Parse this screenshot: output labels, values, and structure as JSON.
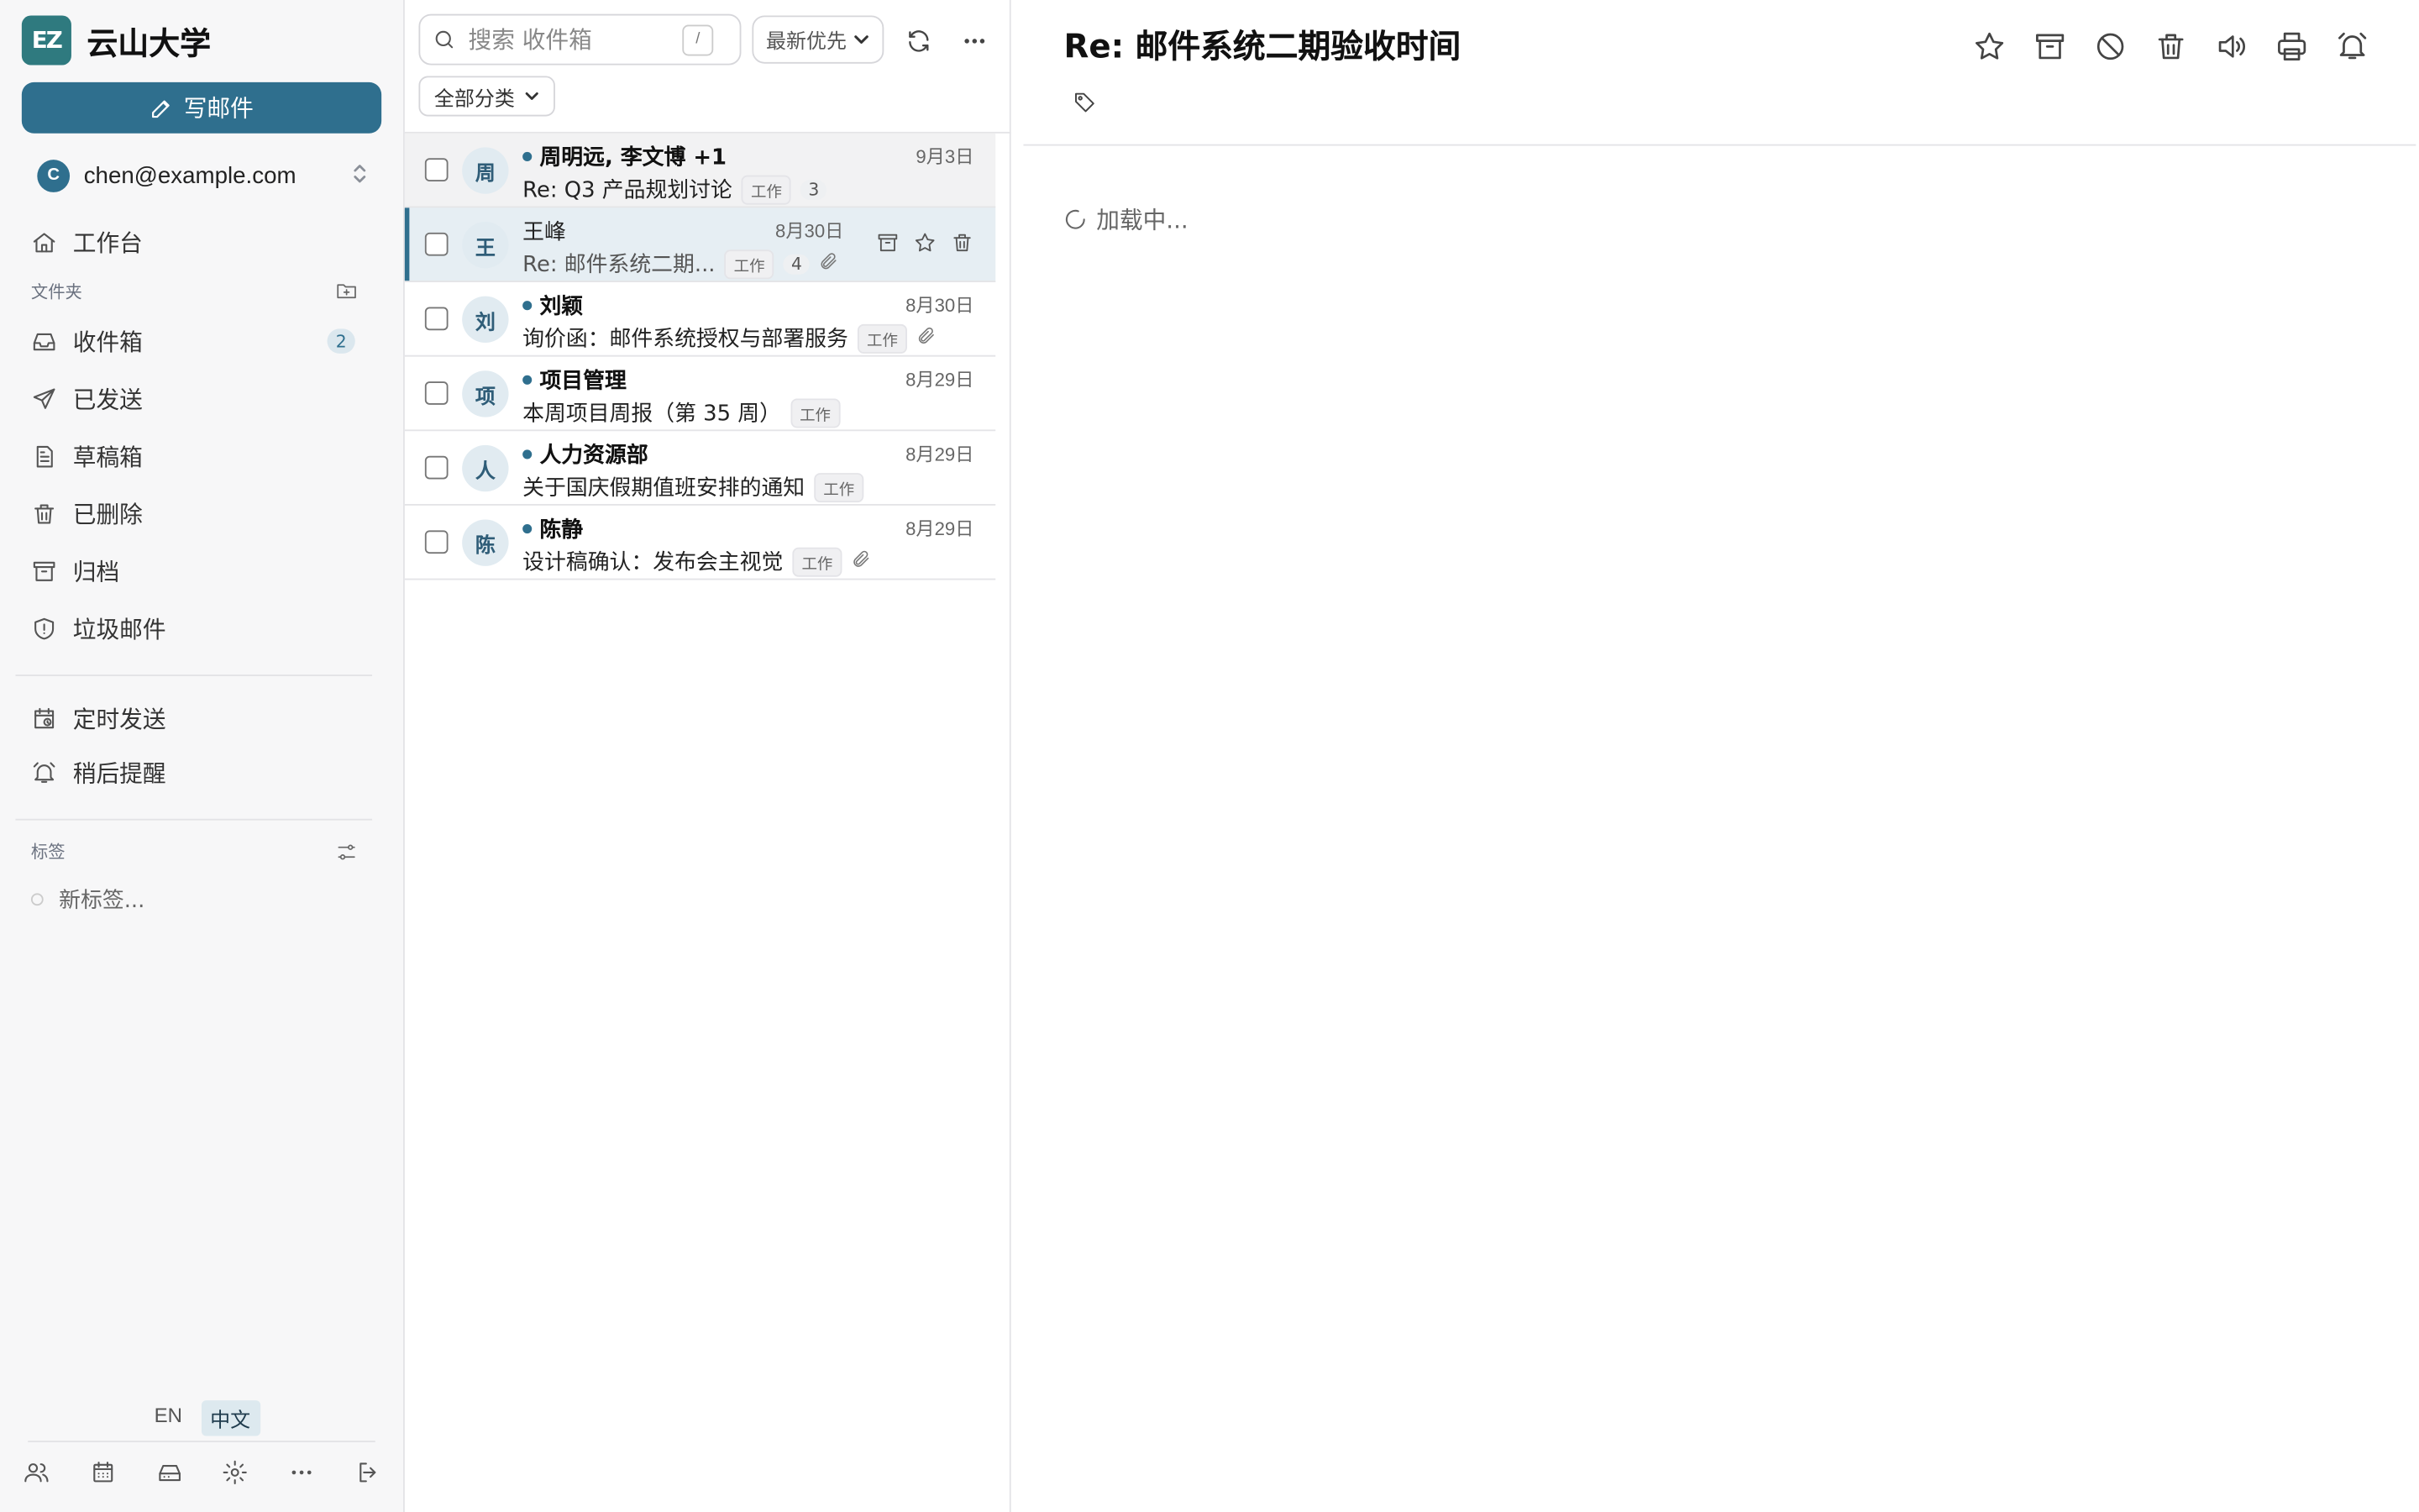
{
  "brand": {
    "logo_text": "EZ",
    "name": "云山大学"
  },
  "compose": {
    "label": "写邮件"
  },
  "account": {
    "initial": "C",
    "email": "chen@example.com"
  },
  "nav": {
    "workspace": "工作台",
    "folders_label": "文件夹",
    "folders": [
      {
        "label": "收件箱",
        "icon": "inbox-icon",
        "badge": "2"
      },
      {
        "label": "已发送",
        "icon": "send-icon"
      },
      {
        "label": "草稿箱",
        "icon": "draft-icon"
      },
      {
        "label": "已删除",
        "icon": "trash-icon"
      },
      {
        "label": "归档",
        "icon": "archive-icon"
      },
      {
        "label": "垃圾邮件",
        "icon": "spam-shield-icon"
      }
    ],
    "scheduled": "定时发送",
    "snoozed": "稍后提醒",
    "tags_label": "标签",
    "new_tag": "新标签..."
  },
  "language": {
    "en": "EN",
    "zh": "中文",
    "active": "中文"
  },
  "bottom_icons": [
    "contacts-icon",
    "calendar-icon",
    "storage-icon",
    "settings-icon",
    "more-icon",
    "logout-icon"
  ],
  "list": {
    "search_placeholder": "搜索 收件箱",
    "search_shortcut": "/",
    "sort_value": "最新优先",
    "filter_label": "全部分类",
    "messages": [
      {
        "initial": "周",
        "sender": "周明远, 李文博 +1",
        "date": "9月3日",
        "subject": "Re: Q3 产品规划讨论",
        "tag": "工作",
        "count": "3",
        "unread": true,
        "attachment": false,
        "state": "hover"
      },
      {
        "initial": "王",
        "sender": "王峰",
        "date": "8月30日",
        "subject": "Re: 邮件系统二期...",
        "tag": "工作",
        "count": "4",
        "unread": false,
        "attachment": true,
        "state": "selected"
      },
      {
        "initial": "刘",
        "sender": "刘颖",
        "date": "8月30日",
        "subject": "询价函：邮件系统授权与部署服务",
        "tag": "工作",
        "count": "",
        "unread": true,
        "attachment": true,
        "state": ""
      },
      {
        "initial": "项",
        "sender": "项目管理",
        "date": "8月29日",
        "subject": "本周项目周报（第 35 周）",
        "tag": "工作",
        "count": "",
        "unread": true,
        "attachment": false,
        "state": ""
      },
      {
        "initial": "人",
        "sender": "人力资源部",
        "date": "8月29日",
        "subject": "关于国庆假期值班安排的通知",
        "tag": "工作",
        "count": "",
        "unread": true,
        "attachment": false,
        "state": ""
      },
      {
        "initial": "陈",
        "sender": "陈静",
        "date": "8月29日",
        "subject": "设计稿确认：发布会主视觉",
        "tag": "工作",
        "count": "",
        "unread": true,
        "attachment": true,
        "state": ""
      }
    ]
  },
  "reader": {
    "title": "Re: 邮件系统二期验收时间",
    "loading_text": "加载中...",
    "tools": [
      "star-icon",
      "archive-icon",
      "block-icon",
      "trash-icon",
      "read-aloud-icon",
      "print-icon",
      "reminder-bell-icon"
    ]
  },
  "colors": {
    "accent": "#2f6f8e",
    "logo": "#2f7a7f",
    "selected_row": "#e6eef3",
    "sidebar_bg": "#f7f7f8"
  }
}
